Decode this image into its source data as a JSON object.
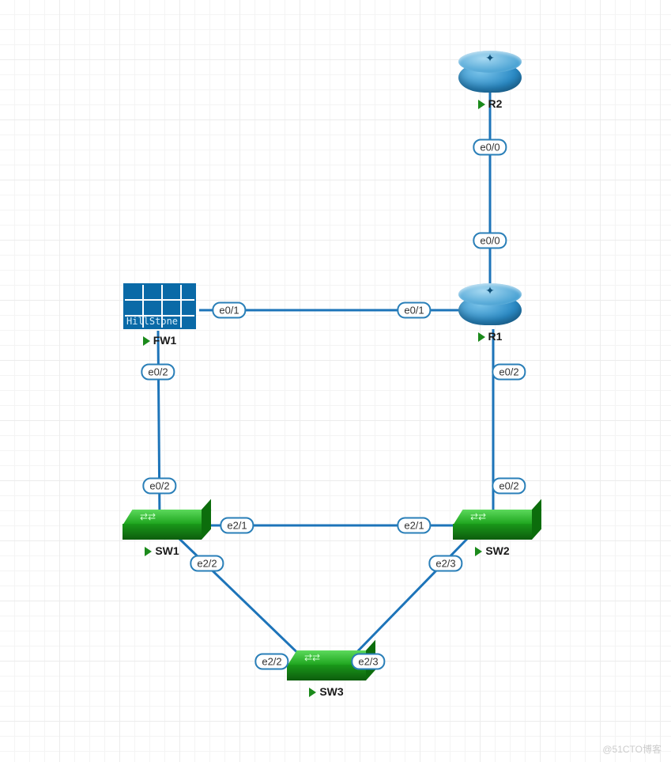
{
  "nodes": {
    "r2": {
      "label": "R2",
      "type": "router"
    },
    "r1": {
      "label": "R1",
      "type": "router"
    },
    "fw1": {
      "label": "FW1",
      "type": "firewall",
      "brand": "HillStone"
    },
    "sw1": {
      "label": "SW1",
      "type": "switch"
    },
    "sw2": {
      "label": "SW2",
      "type": "switch"
    },
    "sw3": {
      "label": "SW3",
      "type": "switch"
    }
  },
  "links": [
    {
      "a": "r2",
      "a_if": "e0/0",
      "b": "r1",
      "b_if": "e0/0"
    },
    {
      "a": "fw1",
      "a_if": "e0/1",
      "b": "r1",
      "b_if": "e0/1"
    },
    {
      "a": "fw1",
      "a_if": "e0/2",
      "b": "sw1",
      "b_if": "e0/2"
    },
    {
      "a": "r1",
      "a_if": "e0/2",
      "b": "sw2",
      "b_if": "e0/2"
    },
    {
      "a": "sw1",
      "a_if": "e2/1",
      "b": "sw2",
      "b_if": "e2/1"
    },
    {
      "a": "sw1",
      "a_if": "e2/2",
      "b": "sw3",
      "b_if": "e2/2"
    },
    {
      "a": "sw2",
      "a_if": "e2/3",
      "b": "sw3",
      "b_if": "e2/3"
    }
  ],
  "ifaces": [
    "e0/0",
    "e0/0",
    "e0/1",
    "e0/1",
    "e0/2",
    "e0/2",
    "e0/2",
    "e0/2",
    "e2/1",
    "e2/1",
    "e2/2",
    "e2/3",
    "e2/2",
    "e2/3"
  ],
  "watermark": "@51CTO博客"
}
